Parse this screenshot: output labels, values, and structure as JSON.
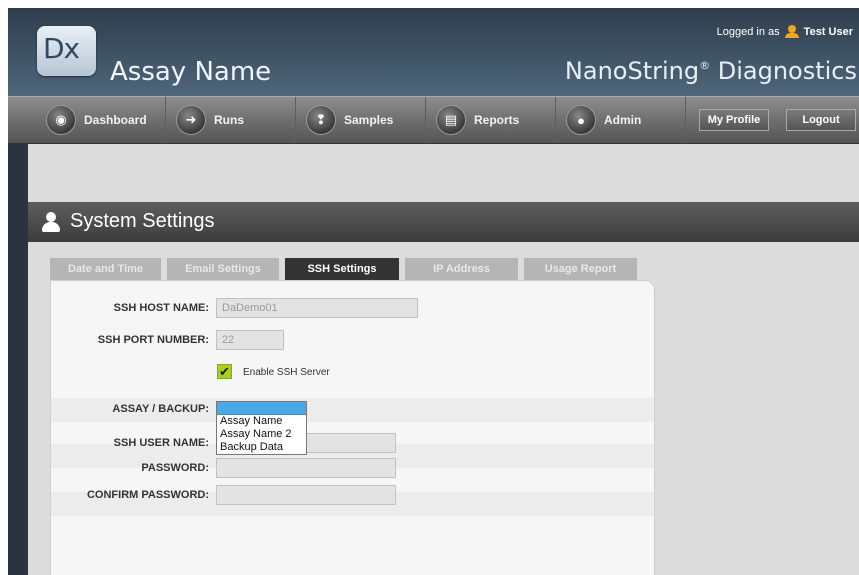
{
  "header": {
    "logo_text": "Dx",
    "app_title": "Assay Name",
    "logged_in_label": "Logged in as",
    "user_name": "Test User",
    "brand_name": "NanoString",
    "brand_mark": "®",
    "brand_suffix": "Diagnostics"
  },
  "nav": {
    "items": [
      {
        "label": "Dashboard",
        "icon": "dashboard-icon",
        "glyph": "◉"
      },
      {
        "label": "Runs",
        "icon": "arrow-right-icon",
        "glyph": "➜"
      },
      {
        "label": "Samples",
        "icon": "sample-tube-icon",
        "glyph": "❢"
      },
      {
        "label": "Reports",
        "icon": "report-icon",
        "glyph": "▤"
      },
      {
        "label": "Admin",
        "icon": "admin-user-icon",
        "glyph": "●"
      }
    ],
    "my_profile": "My Profile",
    "logout": "Logout"
  },
  "page": {
    "title": "System Settings",
    "tabs": [
      "Date and Time",
      "Email Settings",
      "SSH Settings",
      "IP Address",
      "Usage Report"
    ],
    "active_tab": "SSH Settings"
  },
  "form": {
    "host_label": "SSH HOST NAME:",
    "host_value": "DaDemo01",
    "port_label": "SSH PORT NUMBER:",
    "port_value": "22",
    "enable_label": "Enable SSH Server",
    "assay_label": "ASSAY / BACKUP:",
    "assay_options": [
      "Assay Name",
      "Assay Name 2",
      "Backup Data"
    ],
    "user_label": "SSH USER NAME:",
    "password_label": "PASSWORD:",
    "confirm_label": "CONFIRM PASSWORD:"
  },
  "colors": {
    "header_bg": "#3f5466",
    "nav_bg": "#6f6f6f",
    "active_tab": "#333333",
    "checkbox_green": "#a9cf1f",
    "dropdown_highlight": "#4ba7e6"
  }
}
